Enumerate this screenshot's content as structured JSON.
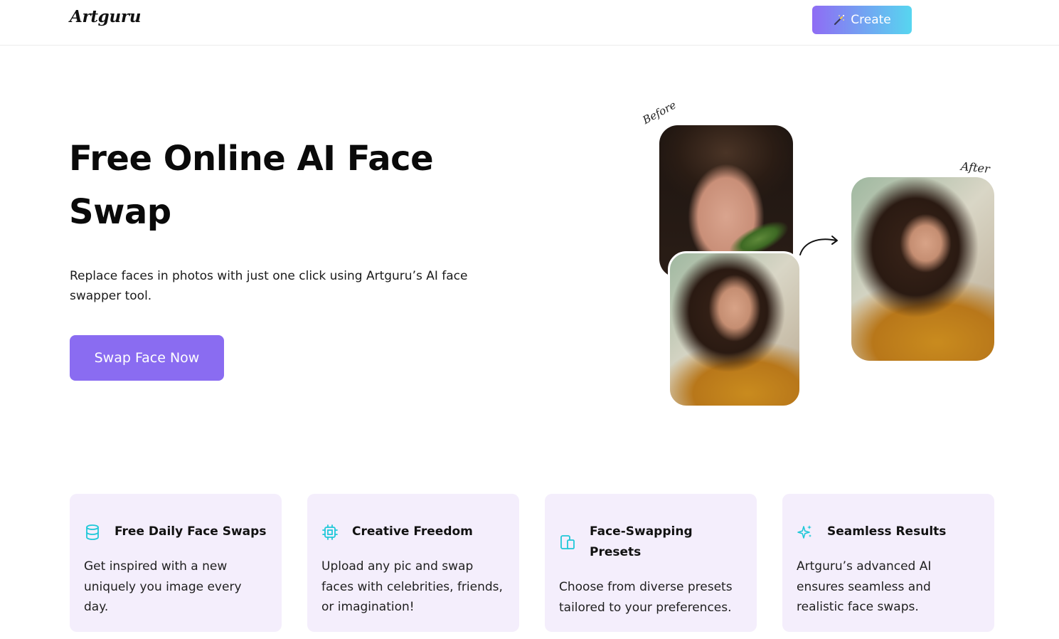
{
  "header": {
    "logo": "Artguru",
    "create_label": "Create",
    "create_icon": "magic-wand-icon"
  },
  "hero": {
    "title": "Free Online AI Face Swap",
    "description": "Replace faces in photos with just one click using Artguru’s AI face swapper tool.",
    "cta_label": "Swap Face Now",
    "before_label": "Before",
    "after_label": "After"
  },
  "features": [
    {
      "icon": "database-icon",
      "title": "Free Daily Face Swaps",
      "description": "Get inspired with a new uniquely you image every day."
    },
    {
      "icon": "chip-icon",
      "title": "Creative Freedom",
      "description": "Upload any pic and swap faces with celebrities, friends, or imagination!"
    },
    {
      "icon": "devices-icon",
      "title": "Face-Swapping Presets",
      "description": "Choose from diverse presets tailored to your preferences."
    },
    {
      "icon": "sparkles-icon",
      "title": "Seamless Results",
      "description": "Artguru’s advanced AI ensures seamless and realistic face swaps."
    }
  ],
  "colors": {
    "accent_purple": "#8a6cf1",
    "icon_teal": "#1fc8d8",
    "card_bg": "#f4eefc"
  }
}
